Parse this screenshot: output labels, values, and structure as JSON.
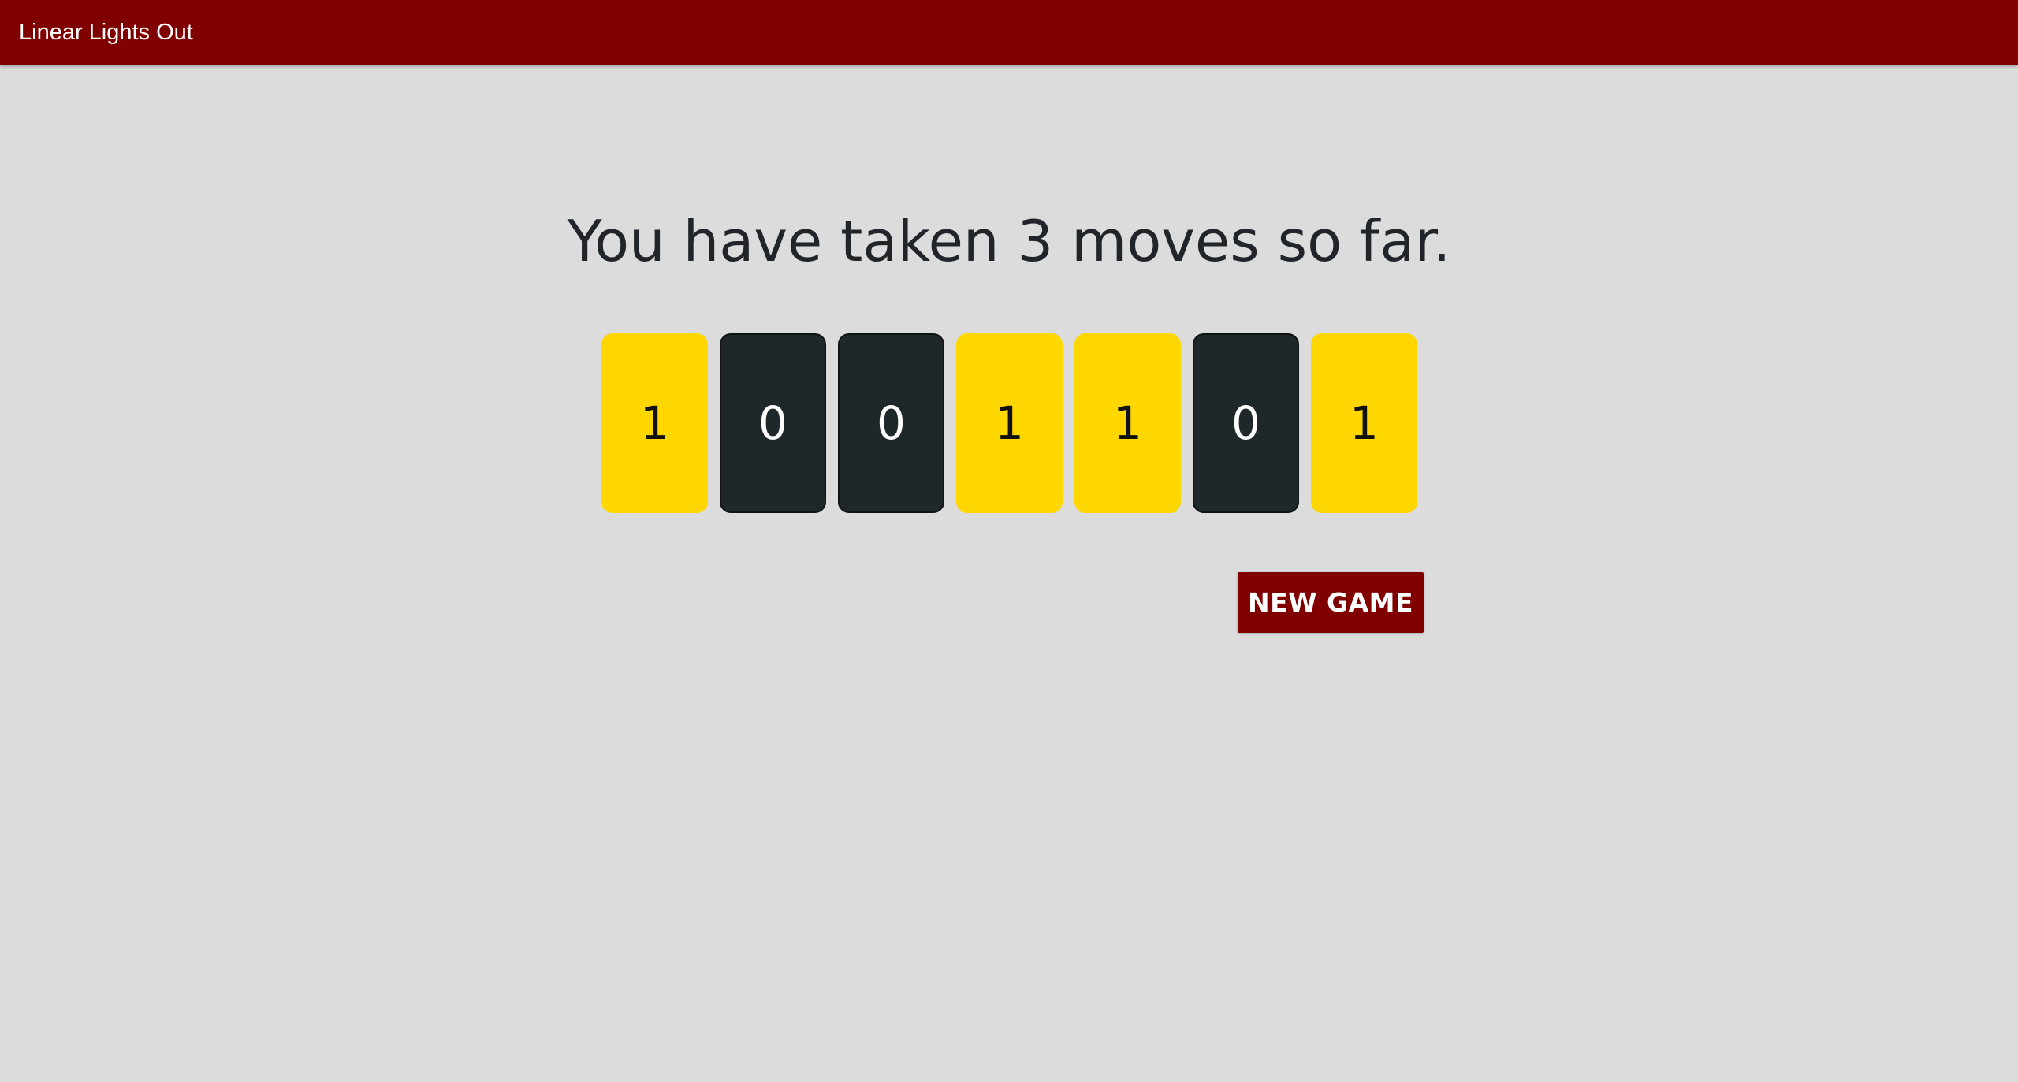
{
  "app_bar": {
    "title": "Linear Lights Out",
    "color": "#800000"
  },
  "status": {
    "moves_text": "You have taken 3 moves so far.",
    "moves": 3
  },
  "board": {
    "lights": [
      {
        "label": "1",
        "state": "on"
      },
      {
        "label": "0",
        "state": "off"
      },
      {
        "label": "0",
        "state": "off"
      },
      {
        "label": "1",
        "state": "on"
      },
      {
        "label": "1",
        "state": "on"
      },
      {
        "label": "0",
        "state": "off"
      },
      {
        "label": "1",
        "state": "on"
      }
    ],
    "on_color": "#ffd700",
    "off_color": "#1e2729"
  },
  "actions": {
    "new_game_label": "NEW GAME"
  }
}
